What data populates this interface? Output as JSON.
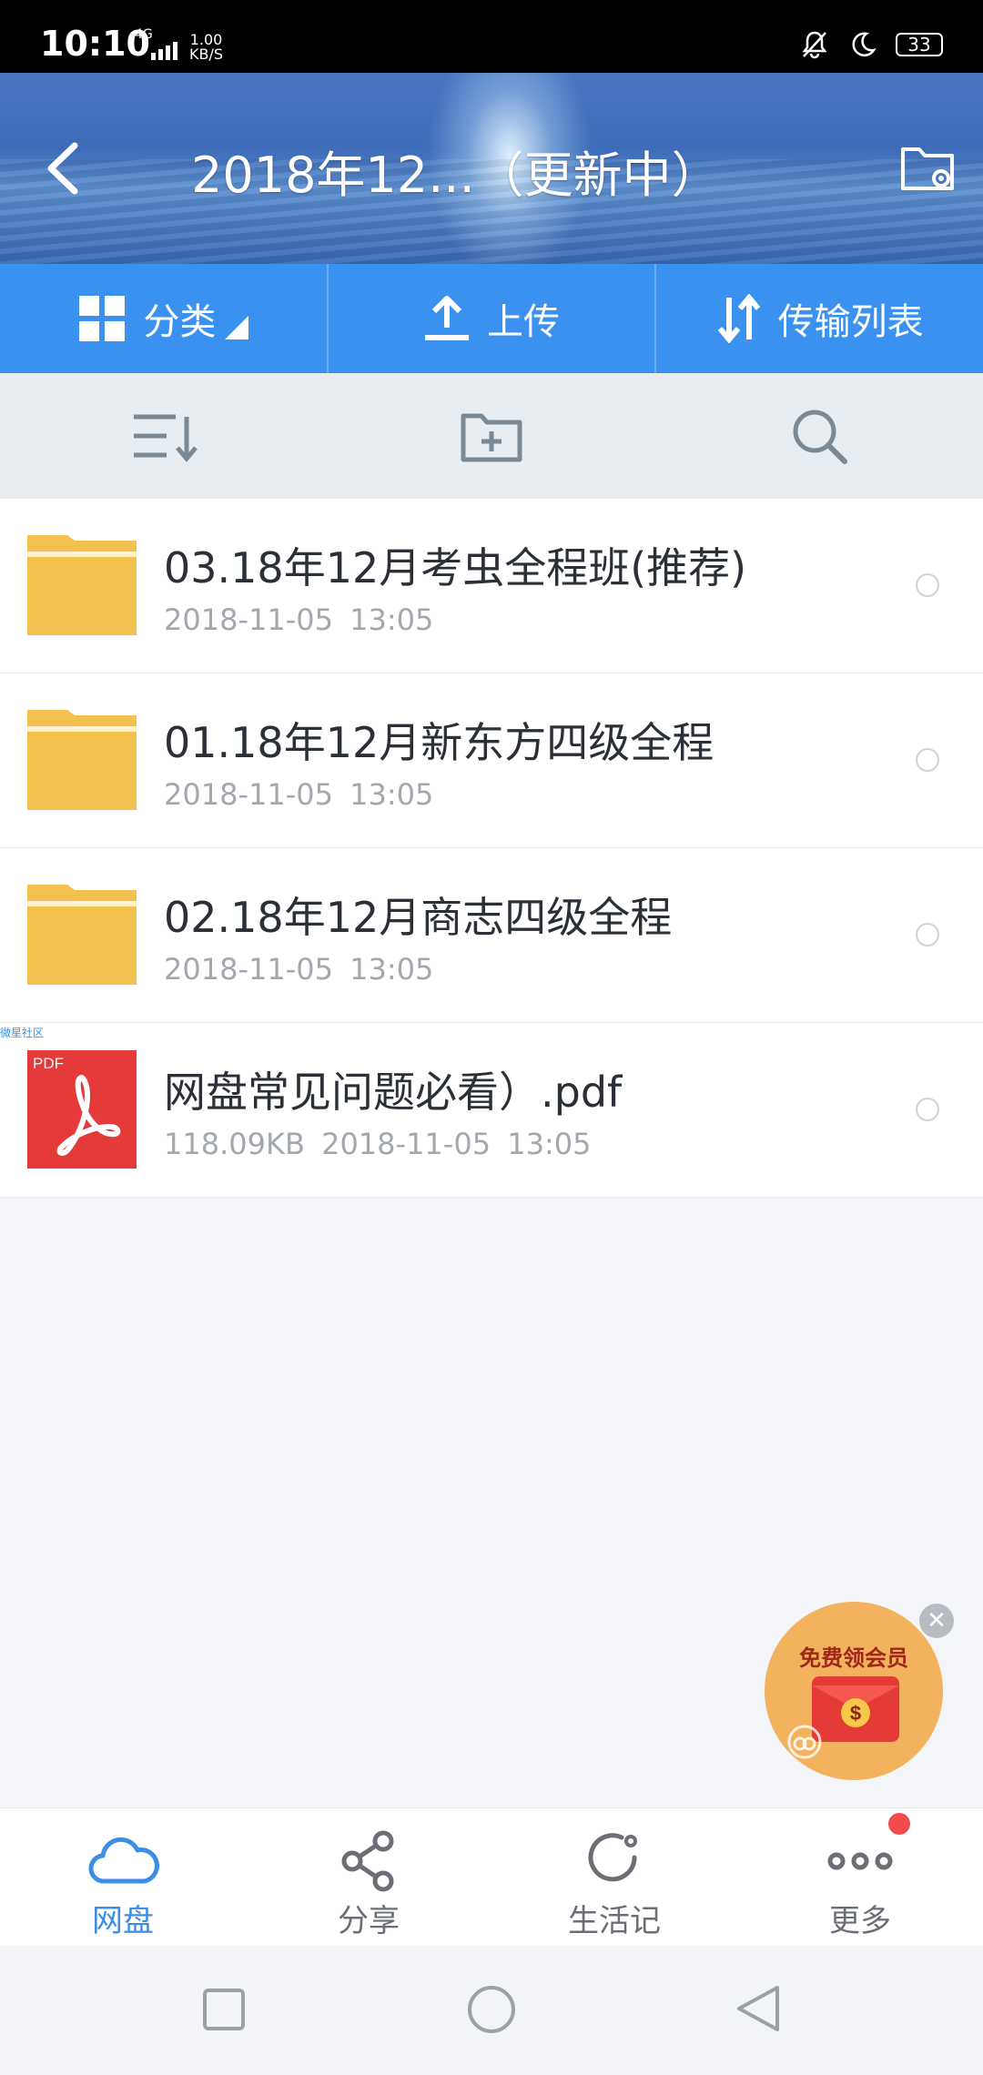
{
  "status_bar": {
    "time": "10:10",
    "network": "4G",
    "speed_value": "1.00",
    "speed_unit": "KB/S",
    "battery": "33"
  },
  "header": {
    "title": "2018年12...（更新中）"
  },
  "toolbar": {
    "category_label": "分类",
    "upload_label": "上传",
    "transfer_label": "传输列表"
  },
  "files": [
    {
      "name": "03.18年12月考虫全程班(推荐)",
      "meta": "2018-11-05  13:05",
      "type": "folder"
    },
    {
      "name": "01.18年12月新东方四级全程",
      "meta": "2018-11-05  13:05",
      "type": "folder"
    },
    {
      "name": "02.18年12月商志四级全程",
      "meta": "2018-11-05  13:05",
      "type": "folder"
    },
    {
      "name": "网盘常见问题必看）.pdf",
      "meta": "118.09KB   2018-11-05  13:05",
      "type": "pdf",
      "tag": "微星社区",
      "icon_label": "PDF"
    }
  ],
  "promo": {
    "text": "免费领会员",
    "coin": "$"
  },
  "bottom_nav": [
    {
      "label": "网盘",
      "icon": "cloud-icon",
      "active": true
    },
    {
      "label": "分享",
      "icon": "share-icon",
      "active": false
    },
    {
      "label": "生活记",
      "icon": "refresh-circle-icon",
      "active": false
    },
    {
      "label": "更多",
      "icon": "more-dots-icon",
      "active": false
    }
  ],
  "colors": {
    "toolbar_blue": "#3b91ef",
    "active_nav": "#3b8ee6",
    "folder": "#f2c14e",
    "pdf": "#e43a3a",
    "badge": "#f24b4b"
  }
}
